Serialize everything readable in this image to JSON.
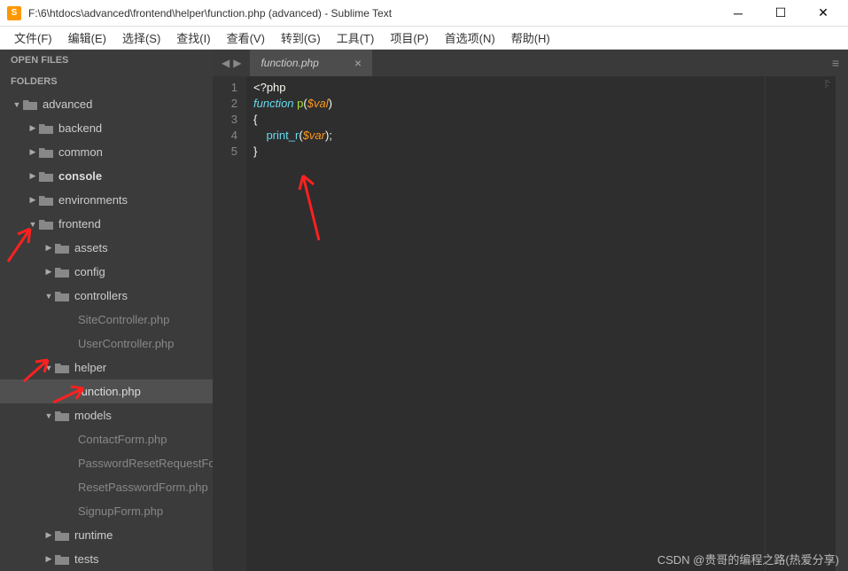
{
  "titlebar": {
    "icon_letter": "S",
    "text": "F:\\6\\htdocs\\advanced\\frontend\\helper\\function.php (advanced) - Sublime Text"
  },
  "menu": {
    "file": "文件(F)",
    "edit": "编辑(E)",
    "select": "选择(S)",
    "find": "查找(I)",
    "view": "查看(V)",
    "goto": "转到(G)",
    "tools": "工具(T)",
    "project": "项目(P)",
    "preferences": "首选项(N)",
    "help": "帮助(H)"
  },
  "sidebar": {
    "open_files": "OPEN FILES",
    "folders": "FOLDERS",
    "tree": {
      "advanced": "advanced",
      "backend": "backend",
      "common": "common",
      "console": "console",
      "environments": "environments",
      "frontend": "frontend",
      "assets": "assets",
      "config": "config",
      "controllers": "controllers",
      "site_controller": "SiteController.php",
      "user_controller": "UserController.php",
      "helper": "helper",
      "function_php": "function.php",
      "models": "models",
      "contact_form": "ContactForm.php",
      "password_reset_request": "PasswordResetRequestForm.php",
      "reset_password_form": "ResetPasswordForm.php",
      "signup_form": "SignupForm.php",
      "runtime": "runtime",
      "tests": "tests"
    }
  },
  "tabs": {
    "active": "function.php"
  },
  "code": {
    "line_numbers": [
      "1",
      "2",
      "3",
      "4",
      "5"
    ],
    "l1_tag": "<?php",
    "l2_kw": "function",
    "l2_fn": "p",
    "l2_var": "$val",
    "l3": "{",
    "l4_fn": "print_r",
    "l4_var": "$var",
    "l5": "}"
  },
  "watermark": "CSDN @贵哥的编程之路(热爱分享)"
}
